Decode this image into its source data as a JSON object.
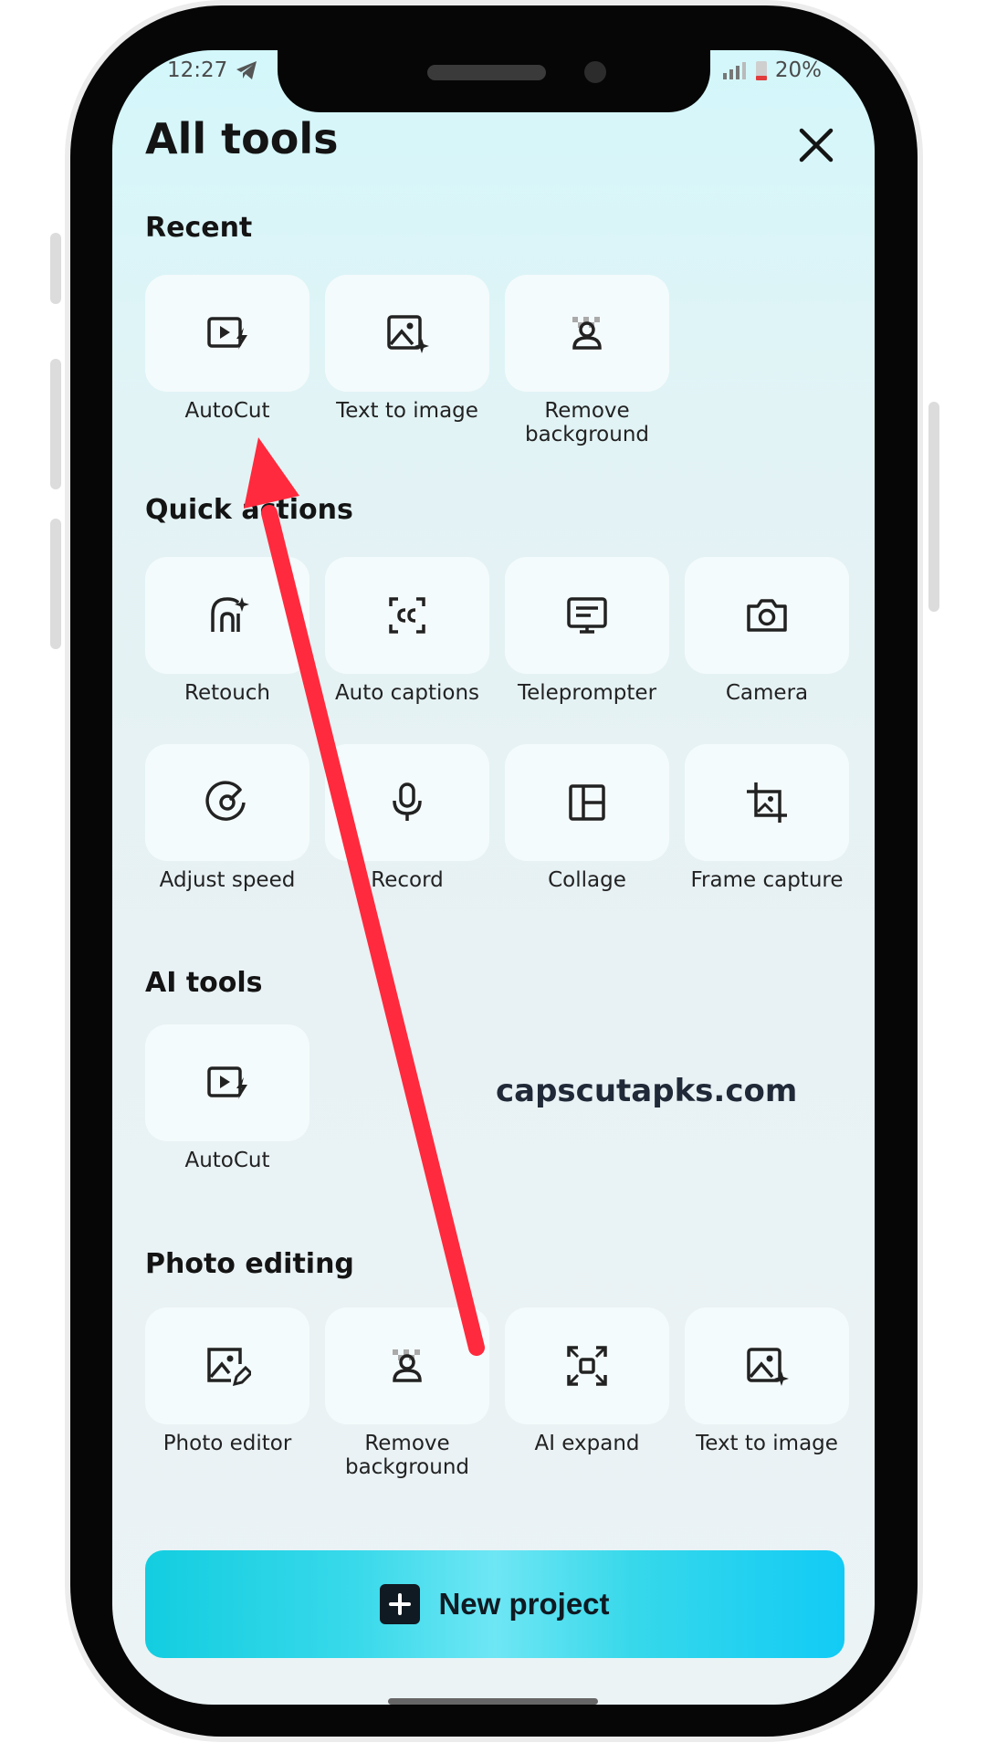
{
  "status_bar": {
    "time": "12:27",
    "battery": "20%"
  },
  "header": {
    "title": "All tools"
  },
  "sections": {
    "recent": {
      "title": "Recent",
      "items": [
        {
          "label": "AutoCut",
          "icon": "autocut-icon"
        },
        {
          "label": "Text to image",
          "icon": "text-to-image-icon"
        },
        {
          "label": "Remove\nbackground",
          "icon": "remove-background-icon"
        }
      ]
    },
    "quick_actions": {
      "title": "Quick actions",
      "items": [
        {
          "label": "Retouch",
          "icon": "retouch-icon"
        },
        {
          "label": "Auto captions",
          "icon": "auto-captions-icon"
        },
        {
          "label": "Teleprompter",
          "icon": "teleprompter-icon"
        },
        {
          "label": "Camera",
          "icon": "camera-icon"
        },
        {
          "label": "Adjust speed",
          "icon": "speed-icon"
        },
        {
          "label": "Record",
          "icon": "microphone-icon"
        },
        {
          "label": "Collage",
          "icon": "collage-icon"
        },
        {
          "label": "Frame capture",
          "icon": "frame-capture-icon"
        }
      ]
    },
    "ai_tools": {
      "title": "AI tools",
      "items": [
        {
          "label": "AutoCut",
          "icon": "autocut-icon"
        }
      ]
    },
    "photo_editing": {
      "title": "Photo editing",
      "items": [
        {
          "label": "Photo editor",
          "icon": "photo-editor-icon"
        },
        {
          "label": "Remove\nbackground",
          "icon": "remove-background-icon"
        },
        {
          "label": "AI expand",
          "icon": "ai-expand-icon"
        },
        {
          "label": "Text to image",
          "icon": "text-to-image-icon"
        }
      ]
    }
  },
  "watermark": "capscutapks.com",
  "footer": {
    "new_project_label": "New project"
  },
  "colors": {
    "accent": "#13cde0",
    "arrow": "#ff2a3d",
    "text": "#141414"
  }
}
